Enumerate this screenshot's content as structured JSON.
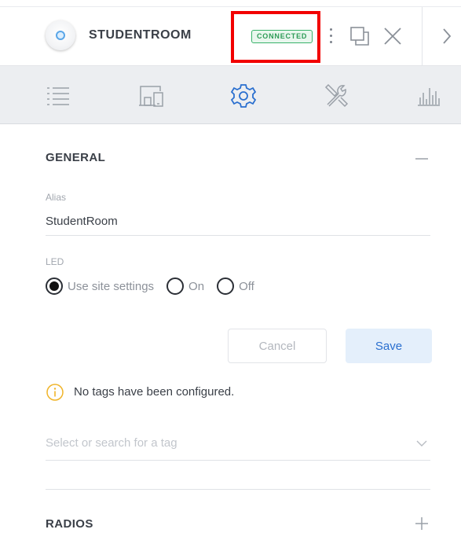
{
  "header": {
    "device_name": "STUDENTROOM",
    "status": "CONNECTED",
    "colors": {
      "status_green": "#38b26a",
      "highlight_red": "#f20000"
    },
    "icons": [
      "device-icon",
      "more-icon",
      "popout-icon",
      "close-icon",
      "chevron-right-icon"
    ]
  },
  "tabs": [
    {
      "icon": "list-icon",
      "active": false
    },
    {
      "icon": "devices-icon",
      "active": false
    },
    {
      "icon": "gear-icon",
      "active": true
    },
    {
      "icon": "tools-icon",
      "active": false
    },
    {
      "icon": "stats-icon",
      "active": false
    }
  ],
  "general": {
    "title": "GENERAL",
    "alias_label": "Alias",
    "alias_value": "StudentRoom",
    "led_label": "LED",
    "led_options": [
      "Use site settings",
      "On",
      "Off"
    ],
    "led_selected": "Use site settings",
    "cancel_label": "Cancel",
    "save_label": "Save",
    "info_text": "No tags have been configured.",
    "tag_placeholder": "Select or search for a tag"
  },
  "radios": {
    "title": "RADIOS"
  },
  "colors": {
    "accent": "#2a6fcf",
    "save_bg": "#e4effb",
    "tabbar_bg": "#eceef1",
    "info_amber": "#f0b429"
  }
}
